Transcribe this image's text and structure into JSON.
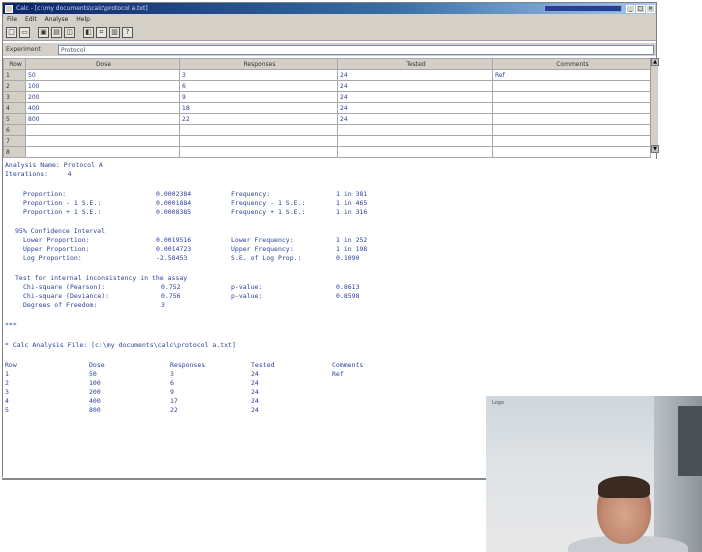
{
  "window": {
    "title": "Calc - [c:\\my documents\\calc\\protocol a.txt]",
    "tray_text": "",
    "win_buttons": [
      "_",
      "□",
      "×"
    ]
  },
  "menu": [
    "File",
    "Edit",
    "Analyse",
    "Help"
  ],
  "toolbar": {
    "buttons": [
      "new-icon",
      "open-icon",
      "save-icon",
      "print-icon",
      "copy-icon",
      "paste-icon",
      "calc-icon",
      "chart-icon",
      "help-icon"
    ]
  },
  "experiment": {
    "label": "Experiment",
    "value": "Protocol"
  },
  "grid": {
    "headers": [
      "Row",
      "Dose",
      "Responses",
      "Tested",
      "Comments"
    ],
    "rows": [
      [
        "1",
        "50",
        "3",
        "24",
        "Ref"
      ],
      [
        "2",
        "100",
        "6",
        "24",
        ""
      ],
      [
        "3",
        "200",
        "9",
        "24",
        ""
      ],
      [
        "4",
        "400",
        "18",
        "24",
        ""
      ],
      [
        "5",
        "800",
        "22",
        "24",
        ""
      ],
      [
        "6",
        "",
        "",
        "",
        ""
      ],
      [
        "7",
        "",
        "",
        "",
        ""
      ],
      [
        "8",
        "",
        "",
        "",
        ""
      ]
    ]
  },
  "output": {
    "analysis_name": "Analysis Name: Protocol A",
    "iterations": "Iterations:     4",
    "stats": [
      {
        "label": "Proportion:",
        "value": "0.0002384",
        "label2": "Frequency:",
        "value2": "1 in 381"
      },
      {
        "label": "Proportion - 1 S.E.:",
        "value": "0.0001884",
        "label2": "Frequency - 1 S.E.:",
        "value2": "1 in 465"
      },
      {
        "label": "Proportion + 1 S.E.:",
        "value": "0.0008385",
        "label2": "Frequency + 1 S.E.:",
        "value2": "1 in 316"
      }
    ],
    "ci_title": "95% Confidence Interval",
    "ci": [
      {
        "label": "Lower Proportion:",
        "value": "0.0019516",
        "label2": "Lower Frequency:",
        "value2": "1 in 252"
      },
      {
        "label": "Upper Proportion:",
        "value": "0.0014723",
        "label2": "Upper Frequency:",
        "value2": "1 in 198"
      },
      {
        "label": "Log Proportion:",
        "value": "-2.58453",
        "label2": "S.E. of Log Prop.:",
        "value2": "0.1090"
      }
    ],
    "chi_title": "Test for internal inconsistency in the assay",
    "chi": [
      {
        "label": "Chi-square (Pearson):",
        "value": "0.752",
        "label2": "p-value:",
        "value2": "0.8613"
      },
      {
        "label": "Chi-square (Deviance):",
        "value": "0.756",
        "label2": "p-value:",
        "value2": "0.8598"
      },
      {
        "label": "Degrees of Freedom:",
        "value": "3",
        "label2": "",
        "value2": ""
      }
    ],
    "separator": "***",
    "file_line": "* Calc Analysis File: [c:\\my documents\\calc\\protocol a.txt]",
    "table_headers": [
      "Row",
      "Dose",
      "Responses",
      "Tested",
      "Comments"
    ],
    "table_rows": [
      [
        "1",
        "50",
        "3",
        "24",
        "Ref"
      ],
      [
        "2",
        "100",
        "6",
        "24",
        ""
      ],
      [
        "3",
        "200",
        "9",
        "24",
        ""
      ],
      [
        "4",
        "400",
        "17",
        "24",
        ""
      ],
      [
        "5",
        "800",
        "22",
        "24",
        ""
      ]
    ]
  },
  "webcam": {
    "label": "Logo"
  }
}
